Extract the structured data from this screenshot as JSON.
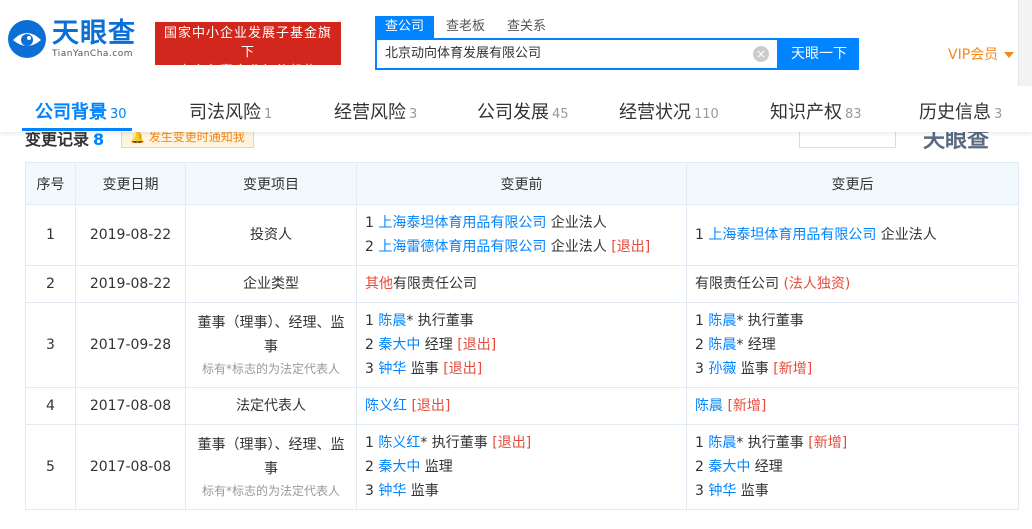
{
  "header": {
    "logo_cn": "天眼查",
    "logo_en": "TianYanCha.com",
    "badge_line1": "国家中小企业发展子基金旗下",
    "badge_line2": "官方备案企业征信机构",
    "search_tabs": [
      "查公司",
      "查老板",
      "查关系"
    ],
    "search_value": "北京动向体育发展有限公司",
    "search_button": "天眼一下",
    "vip": "VIP会员"
  },
  "nav": [
    {
      "label": "公司背景",
      "count": "30"
    },
    {
      "label": "司法风险",
      "count": "1"
    },
    {
      "label": "经营风险",
      "count": "3"
    },
    {
      "label": "公司发展",
      "count": "45"
    },
    {
      "label": "经营状况",
      "count": "110"
    },
    {
      "label": "知识产权",
      "count": "83"
    },
    {
      "label": "历史信息",
      "count": "3"
    }
  ],
  "section": {
    "title": "变更记录",
    "count": "8",
    "notify": "发生变更时通知我",
    "watermark": "天眼查"
  },
  "table": {
    "headers": [
      "序号",
      "变更日期",
      "变更项目",
      "变更前",
      "变更后"
    ],
    "rows": [
      {
        "no": "1",
        "date": "2019-08-22",
        "item": "投资人",
        "item_note": "",
        "before": [
          [
            {
              "t": "1 "
            },
            {
              "t": "上海泰坦体育用品有限公司",
              "s": "lnk"
            },
            {
              "t": " 企业法人"
            }
          ],
          [
            {
              "t": "2 "
            },
            {
              "t": "上海雷德体育用品有限公司",
              "s": "lnk"
            },
            {
              "t": " 企业法人 "
            },
            {
              "t": "[退出]",
              "s": "red"
            }
          ]
        ],
        "after": [
          [
            {
              "t": "1 "
            },
            {
              "t": "上海泰坦体育用品有限公司",
              "s": "lnk"
            },
            {
              "t": " 企业法人"
            }
          ]
        ]
      },
      {
        "no": "2",
        "date": "2019-08-22",
        "item": "企业类型",
        "item_note": "",
        "before": [
          [
            {
              "t": "其他",
              "s": "red"
            },
            {
              "t": "有限责任公司"
            }
          ]
        ],
        "after": [
          [
            {
              "t": "有限责任公司 "
            },
            {
              "t": "(法人独资)",
              "s": "red"
            }
          ]
        ]
      },
      {
        "no": "3",
        "date": "2017-09-28",
        "item": "董事（理事）、经理、监事",
        "item_note": "标有*标志的为法定代表人",
        "before": [
          [
            {
              "t": "1 "
            },
            {
              "t": "陈晨",
              "s": "lnk"
            },
            {
              "t": "* 执行董事"
            }
          ],
          [
            {
              "t": "2 "
            },
            {
              "t": "秦大中",
              "s": "lnk"
            },
            {
              "t": " 经理 "
            },
            {
              "t": "[退出]",
              "s": "red"
            }
          ],
          [
            {
              "t": "3 "
            },
            {
              "t": "钟华",
              "s": "lnk"
            },
            {
              "t": " 监事 "
            },
            {
              "t": "[退出]",
              "s": "red"
            }
          ]
        ],
        "after": [
          [
            {
              "t": "1 "
            },
            {
              "t": "陈晨",
              "s": "lnk"
            },
            {
              "t": "* 执行董事"
            }
          ],
          [
            {
              "t": "2 "
            },
            {
              "t": "陈晨",
              "s": "lnk"
            },
            {
              "t": "* 经理"
            }
          ],
          [
            {
              "t": "3 "
            },
            {
              "t": "孙薇",
              "s": "lnk"
            },
            {
              "t": " 监事 "
            },
            {
              "t": "[新增]",
              "s": "red"
            }
          ]
        ]
      },
      {
        "no": "4",
        "date": "2017-08-08",
        "item": "法定代表人",
        "item_note": "",
        "before": [
          [
            {
              "t": "陈义红",
              "s": "lnk"
            },
            {
              "t": " "
            },
            {
              "t": "[退出]",
              "s": "red"
            }
          ]
        ],
        "after": [
          [
            {
              "t": "陈晨",
              "s": "lnk"
            },
            {
              "t": " "
            },
            {
              "t": "[新增]",
              "s": "red"
            }
          ]
        ]
      },
      {
        "no": "5",
        "date": "2017-08-08",
        "item": "董事（理事）、经理、监事",
        "item_note": "标有*标志的为法定代表人",
        "before": [
          [
            {
              "t": "1 "
            },
            {
              "t": "陈义红",
              "s": "lnk"
            },
            {
              "t": "* 执行董事 "
            },
            {
              "t": "[退出]",
              "s": "red"
            }
          ],
          [
            {
              "t": "2 "
            },
            {
              "t": "秦大中",
              "s": "lnk"
            },
            {
              "t": " 监理"
            }
          ],
          [
            {
              "t": "3 "
            },
            {
              "t": "钟华",
              "s": "lnk"
            },
            {
              "t": " 监事"
            }
          ]
        ],
        "after": [
          [
            {
              "t": "1 "
            },
            {
              "t": "陈晨",
              "s": "lnk"
            },
            {
              "t": "* 执行董事 "
            },
            {
              "t": "[新增]",
              "s": "red"
            }
          ],
          [
            {
              "t": "2 "
            },
            {
              "t": "秦大中",
              "s": "lnk"
            },
            {
              "t": " 经理"
            }
          ],
          [
            {
              "t": "3 "
            },
            {
              "t": "钟华",
              "s": "lnk"
            },
            {
              "t": " 监事"
            }
          ]
        ]
      }
    ]
  },
  "colors": {
    "primary": "#0084ff",
    "badge": "#d2271d",
    "vip": "#f28a1b",
    "alert": "#e64b3b",
    "header_bg": "#f2f9fc"
  }
}
